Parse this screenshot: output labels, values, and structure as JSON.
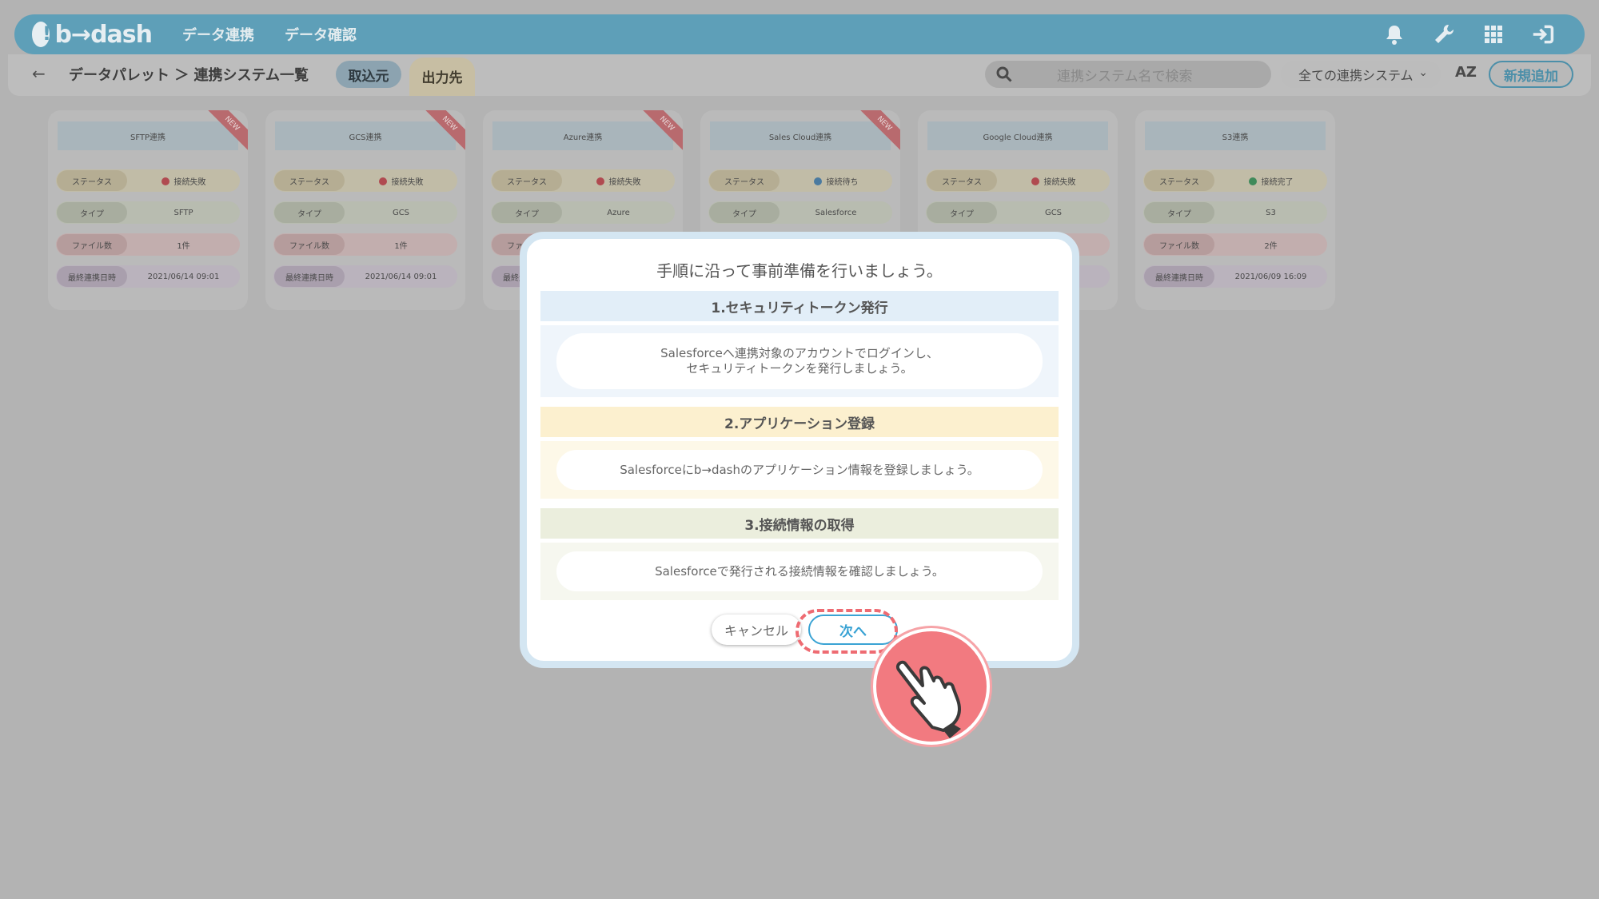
{
  "header": {
    "logo": "b→dash",
    "nav": [
      "データ連携",
      "データ確認"
    ]
  },
  "subbar": {
    "breadcrumb": "データパレット ＞ 連携システム一覧",
    "tab_source": "取込元",
    "tab_destination": "出力先",
    "search_placeholder": "連携システム名で検索",
    "filter_value": "全ての連携システム",
    "sort_label": "AZ",
    "add_button": "新規追加"
  },
  "card_labels": {
    "status": "ステータス",
    "type": "タイプ",
    "files": "ファイル数",
    "last_sync": "最終連携日時",
    "new_badge": "NEW"
  },
  "cards": [
    {
      "title": "SFTP連携",
      "is_new": true,
      "status": "接続失敗",
      "status_color": "#b04a50",
      "type": "SFTP",
      "files": "1件",
      "last_sync": "2021/06/14 09:01"
    },
    {
      "title": "GCS連携",
      "is_new": true,
      "status": "接続失敗",
      "status_color": "#b04a50",
      "type": "GCS",
      "files": "1件",
      "last_sync": "2021/06/14 09:01"
    },
    {
      "title": "Azure連携",
      "is_new": true,
      "status": "接続失敗",
      "status_color": "#b04a50",
      "type": "Azure",
      "files": "",
      "last_sync": ""
    },
    {
      "title": "Sales Cloud連携",
      "is_new": true,
      "status": "接続待ち",
      "status_color": "#4a7aa0",
      "type": "Salesforce",
      "files": "",
      "last_sync": ""
    },
    {
      "title": "Google Cloud連携",
      "is_new": false,
      "status": "接続失敗",
      "status_color": "#b04a50",
      "type": "GCS",
      "files": "",
      "last_sync": ""
    },
    {
      "title": "S3連携",
      "is_new": false,
      "status": "接続完了",
      "status_color": "#3f8a5a",
      "type": "S3",
      "files": "2件",
      "last_sync": "2021/06/09 16:09"
    }
  ],
  "modal": {
    "title": "手順に沿って事前準備を行いましょう。",
    "steps": [
      {
        "heading": "1.セキュリティトークン発行",
        "text_line1": "Salesforceへ連携対象のアカウントでログインし、",
        "text_line2": "セキュリティトークンを発行しましょう。"
      },
      {
        "heading": "2.アプリケーション登録",
        "text_line1": "Salesforceにb→dashのアプリケーション情報を登録しましょう。"
      },
      {
        "heading": "3.接続情報の取得",
        "text_line1": "Salesforceで発行される接続情報を確認しましょう。"
      }
    ],
    "cancel_button": "キャンセル",
    "next_button": "次へ"
  },
  "colors": {
    "accent": "#3aa3d4",
    "highlight": "#ee6b72"
  }
}
